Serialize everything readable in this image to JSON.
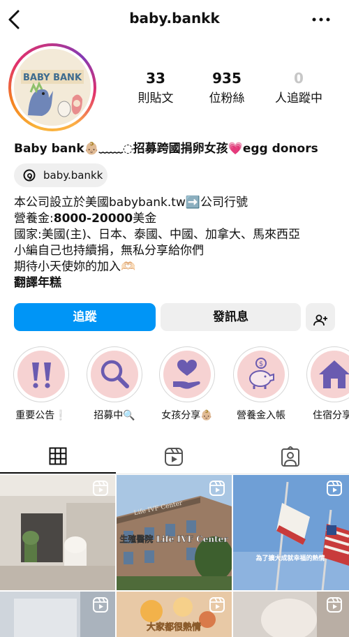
{
  "header": {
    "username": "baby.bankk"
  },
  "profile": {
    "avatar_text": "BABY BANK",
    "stats": [
      {
        "value": "33",
        "label": "則貼文"
      },
      {
        "value": "935",
        "label": "位粉絲"
      },
      {
        "value": "0",
        "label": "人追蹤中"
      }
    ],
    "display_name": "Baby bank👶🏼﹏﹏◌招募跨國捐卵女孩💗egg donors",
    "threads_handle": "baby.bankk",
    "bio_lines": [
      "本公司設立於美國babybank.tw➡️公司行號",
      "營養金:",
      "8000-20000",
      "美金",
      "國家:美國(主)、日本、泰國、中國、加拿大、馬來西亞",
      "小編自己也持續捐，無私分享給你們",
      "期待小天使妳的加入🫶🏻",
      "翻譯年糕"
    ]
  },
  "actions": {
    "follow": "追蹤",
    "message": "發訊息"
  },
  "highlights": [
    {
      "label": "重要公告❕",
      "icon": "exclamation-icon"
    },
    {
      "label": "招募中🔍",
      "icon": "magnifier-icon"
    },
    {
      "label": "女孩分享👶🏼",
      "icon": "heart-hand-icon"
    },
    {
      "label": "營養金入帳",
      "icon": "piggy-bank-icon"
    },
    {
      "label": "住宿分享",
      "icon": "house-icon"
    }
  ],
  "tabs": [
    "grid-icon",
    "reels-icon",
    "tagged-icon"
  ],
  "posts": [
    {
      "caption": ""
    },
    {
      "caption": "生殖醫院 Life IVF Center",
      "sign": "Life IVF Center"
    },
    {
      "caption": "為了擴大成就幸福的熱情"
    },
    {
      "caption": ""
    },
    {
      "caption": "大家都很熱情"
    },
    {
      "caption": ""
    }
  ],
  "colors": {
    "accent": "#0095f6",
    "button_gray": "#efefef",
    "highlight_bg": "#f6d2d2",
    "highlight_icon": "#6a5bb0"
  }
}
